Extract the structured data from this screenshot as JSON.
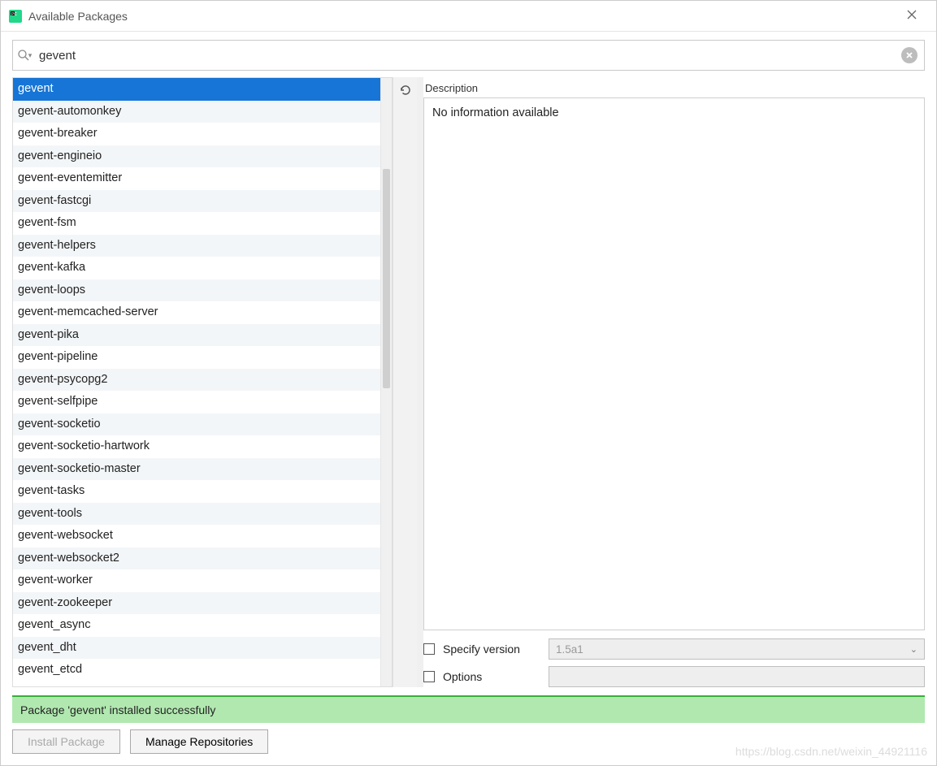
{
  "window": {
    "title": "Available Packages"
  },
  "search": {
    "value": "gevent"
  },
  "packages": [
    "gevent",
    "gevent-automonkey",
    "gevent-breaker",
    "gevent-engineio",
    "gevent-eventemitter",
    "gevent-fastcgi",
    "gevent-fsm",
    "gevent-helpers",
    "gevent-kafka",
    "gevent-loops",
    "gevent-memcached-server",
    "gevent-pika",
    "gevent-pipeline",
    "gevent-psycopg2",
    "gevent-selfpipe",
    "gevent-socketio",
    "gevent-socketio-hartwork",
    "gevent-socketio-master",
    "gevent-tasks",
    "gevent-tools",
    "gevent-websocket",
    "gevent-websocket2",
    "gevent-worker",
    "gevent-zookeeper",
    "gevent_async",
    "gevent_dht",
    "gevent_etcd"
  ],
  "selected_index": 0,
  "description": {
    "label": "Description",
    "text": "No information available"
  },
  "options": {
    "specify_version_label": "Specify version",
    "specify_version_value": "1.5a1",
    "options_label": "Options"
  },
  "status": "Package 'gevent' installed successfully",
  "buttons": {
    "install": "Install Package",
    "manage": "Manage Repositories"
  },
  "watermark": "https://blog.csdn.net/weixin_44921116"
}
